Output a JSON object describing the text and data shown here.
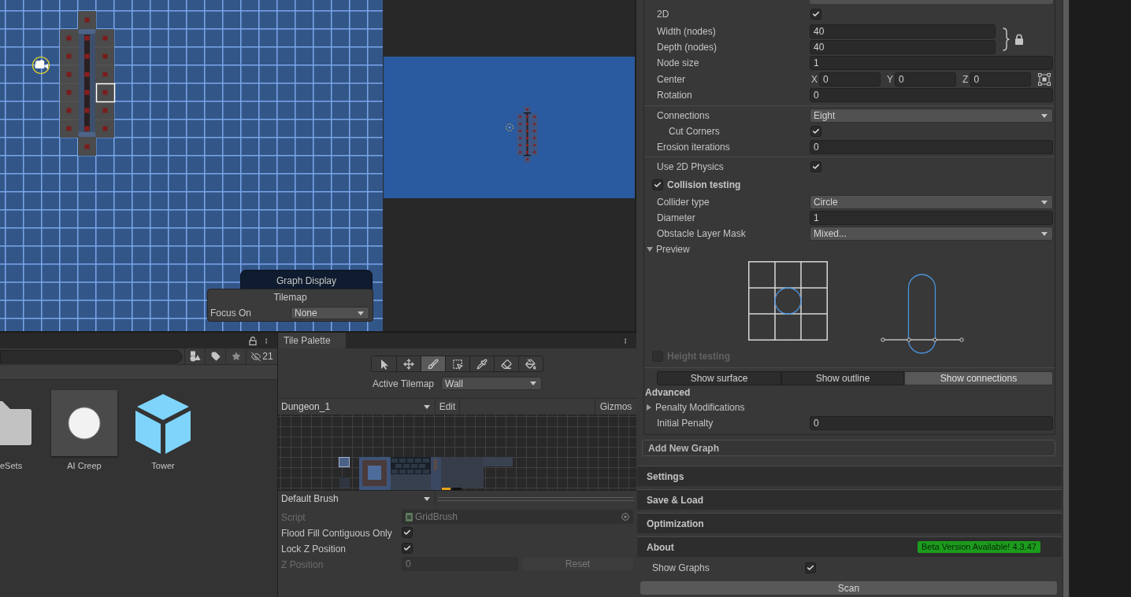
{
  "scene_view": {
    "graph_display": {
      "title": "Graph Display"
    },
    "tilemap_overlay": {
      "title": "Tilemap",
      "label": "Focus On",
      "value": "None"
    }
  },
  "project": {
    "hidden_count": "21",
    "items": [
      {
        "kind": "folder",
        "name": "eSets"
      },
      {
        "kind": "sprite",
        "name": "AI Creep"
      },
      {
        "kind": "prefab",
        "name": "Tower"
      }
    ]
  },
  "tile_palette": {
    "tab": "Tile Palette",
    "tools": [
      {
        "kind": "select",
        "selected": false
      },
      {
        "kind": "move",
        "selected": false
      },
      {
        "kind": "paint",
        "selected": true
      },
      {
        "kind": "box",
        "selected": false
      },
      {
        "kind": "pick",
        "selected": false
      },
      {
        "kind": "erase",
        "selected": false
      },
      {
        "kind": "fill",
        "selected": false
      }
    ],
    "active_tilemap": {
      "label": "Active Tilemap",
      "value": "Wall"
    },
    "palette": {
      "value": "Dungeon_1",
      "edit": "Edit",
      "gizmos": "Gizmos"
    },
    "brush": "Default Brush",
    "properties": [
      {
        "kind": "object",
        "label": "Script",
        "value": "GridBrush",
        "disabled": true
      },
      {
        "kind": "checkbox",
        "label": "Flood Fill Contiguous Only",
        "checked": true
      },
      {
        "kind": "checkbox",
        "label": "Lock Z Position",
        "checked": true
      },
      {
        "kind": "number",
        "label": "Z Position",
        "value": "0",
        "button": "Reset",
        "disabled": true
      }
    ]
  },
  "inspector": {
    "groups": [
      {
        "rows": [
          {
            "kind": "checkbox",
            "label": "2D",
            "checked": true
          },
          {
            "kind": "linked",
            "fields": [
              {
                "label": "Width (nodes)",
                "value": "40"
              },
              {
                "label": "Depth (nodes)",
                "value": "40"
              }
            ]
          },
          {
            "kind": "field",
            "label": "Node size",
            "value": "1"
          },
          {
            "kind": "vector",
            "label": "Center",
            "axes": [
              {
                "axis": "X",
                "value": "0"
              },
              {
                "axis": "Y",
                "value": "0"
              },
              {
                "axis": "Z",
                "value": "0"
              }
            ]
          },
          {
            "kind": "field",
            "label": "Rotation",
            "value": "0"
          }
        ]
      },
      {
        "rows": [
          {
            "kind": "dropdown",
            "label": "Connections",
            "value": "Eight",
            "children": [
              {
                "kind": "checkbox",
                "label": "Cut Corners",
                "checked": true
              }
            ]
          },
          {
            "kind": "field",
            "label": "Erosion iterations",
            "value": "0"
          }
        ]
      },
      {
        "rows": [
          {
            "kind": "checkbox",
            "label": "Use 2D Physics",
            "checked": true
          },
          {
            "kind": "toggle",
            "label": "Collision testing",
            "checked": true
          },
          {
            "kind": "dropdown",
            "label": "Collider type",
            "value": "Circle"
          },
          {
            "kind": "field",
            "label": "Diameter",
            "value": "1"
          },
          {
            "kind": "dropdown",
            "label": "Obstacle Layer Mask",
            "value": "Mixed..."
          },
          {
            "kind": "foldout",
            "label": "Preview",
            "expanded": true,
            "children": [
              {
                "kind": "preview"
              }
            ]
          },
          {
            "kind": "toggle",
            "label": "Height testing",
            "checked": false,
            "disabled": true
          }
        ]
      }
    ],
    "display_buttons": [
      {
        "label": "Show surface",
        "selected": false
      },
      {
        "label": "Show outline",
        "selected": false
      },
      {
        "label": "Show connections",
        "selected": true
      }
    ],
    "advanced": {
      "title": "Advanced",
      "rows": [
        {
          "kind": "foldout",
          "label": "Penalty Modifications",
          "expanded": false
        },
        {
          "kind": "field",
          "label": "Initial Penalty",
          "value": "0"
        }
      ]
    },
    "add_graph": "Add New Graph",
    "sections": [
      {
        "title": "Settings"
      },
      {
        "title": "Save & Load"
      },
      {
        "title": "Optimization"
      },
      {
        "title": "About",
        "badge": "Beta Version Available! 4.3.47"
      }
    ],
    "show_graphs": {
      "label": "Show Graphs",
      "checked": true
    },
    "scan": "Scan"
  }
}
